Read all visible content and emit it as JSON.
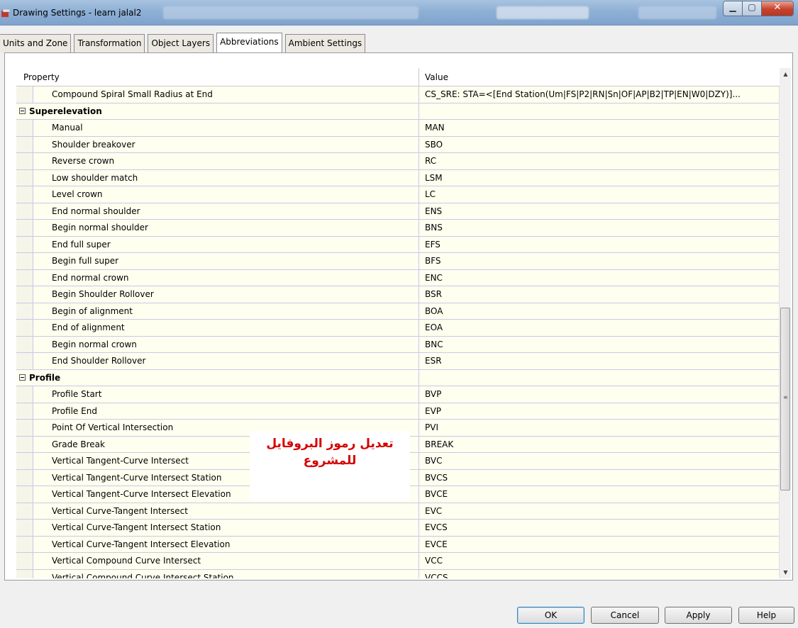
{
  "window": {
    "title": "Drawing Settings - learn jalal2"
  },
  "tabs": [
    {
      "label": "Units and Zone"
    },
    {
      "label": "Transformation"
    },
    {
      "label": "Object Layers"
    },
    {
      "label": "Abbreviations"
    },
    {
      "label": "Ambient Settings"
    }
  ],
  "grid": {
    "header_property": "Property",
    "header_value": "Value",
    "rows": [
      {
        "type": "item",
        "property": "Compound Spiral Small Radius at End",
        "value": "CS_SRE: STA=<[End Station(Um|FS|P2|RN|Sn|OF|AP|B2|TP|EN|W0|DZY)]..."
      },
      {
        "type": "category",
        "property": "Superelevation",
        "value": ""
      },
      {
        "type": "item",
        "property": "Manual",
        "value": "MAN"
      },
      {
        "type": "item",
        "property": "Shoulder breakover",
        "value": "SBO"
      },
      {
        "type": "item",
        "property": "Reverse crown",
        "value": "RC"
      },
      {
        "type": "item",
        "property": "Low shoulder match",
        "value": "LSM"
      },
      {
        "type": "item",
        "property": "Level crown",
        "value": "LC"
      },
      {
        "type": "item",
        "property": "End normal shoulder",
        "value": "ENS"
      },
      {
        "type": "item",
        "property": "Begin normal shoulder",
        "value": "BNS"
      },
      {
        "type": "item",
        "property": "End full super",
        "value": "EFS"
      },
      {
        "type": "item",
        "property": "Begin full super",
        "value": "BFS"
      },
      {
        "type": "item",
        "property": "End normal crown",
        "value": "ENC"
      },
      {
        "type": "item",
        "property": "Begin Shoulder Rollover",
        "value": "BSR"
      },
      {
        "type": "item",
        "property": "Begin of alignment",
        "value": "BOA"
      },
      {
        "type": "item",
        "property": "End of alignment",
        "value": "EOA"
      },
      {
        "type": "item",
        "property": "Begin normal crown",
        "value": "BNC"
      },
      {
        "type": "item",
        "property": "End Shoulder Rollover",
        "value": "ESR"
      },
      {
        "type": "category",
        "property": "Profile",
        "value": ""
      },
      {
        "type": "item",
        "property": "Profile Start",
        "value": "BVP"
      },
      {
        "type": "item",
        "property": "Profile End",
        "value": "EVP"
      },
      {
        "type": "item",
        "property": "Point Of Vertical Intersection",
        "value": "PVI"
      },
      {
        "type": "item",
        "property": "Grade Break",
        "value": "BREAK"
      },
      {
        "type": "item",
        "property": "Vertical Tangent-Curve Intersect",
        "value": "BVC"
      },
      {
        "type": "item",
        "property": "Vertical Tangent-Curve Intersect Station",
        "value": "BVCS"
      },
      {
        "type": "item",
        "property": "Vertical Tangent-Curve Intersect Elevation",
        "value": "BVCE"
      },
      {
        "type": "item",
        "property": "Vertical Curve-Tangent Intersect",
        "value": "EVC"
      },
      {
        "type": "item",
        "property": "Vertical Curve-Tangent Intersect Station",
        "value": "EVCS"
      },
      {
        "type": "item",
        "property": "Vertical Curve-Tangent Intersect Elevation",
        "value": "EVCE"
      },
      {
        "type": "item",
        "property": "Vertical Compound Curve Intersect",
        "value": "VCC"
      },
      {
        "type": "item",
        "property": "Vertical Compound Curve Intersect Station",
        "value": "VCCS"
      }
    ]
  },
  "annotation": {
    "line1": "تعديل رموز البروفايل",
    "line2": "للمشروع",
    "color": "#d40000"
  },
  "buttons": {
    "ok": "OK",
    "cancel": "Cancel",
    "apply": "Apply",
    "help": "Help"
  }
}
